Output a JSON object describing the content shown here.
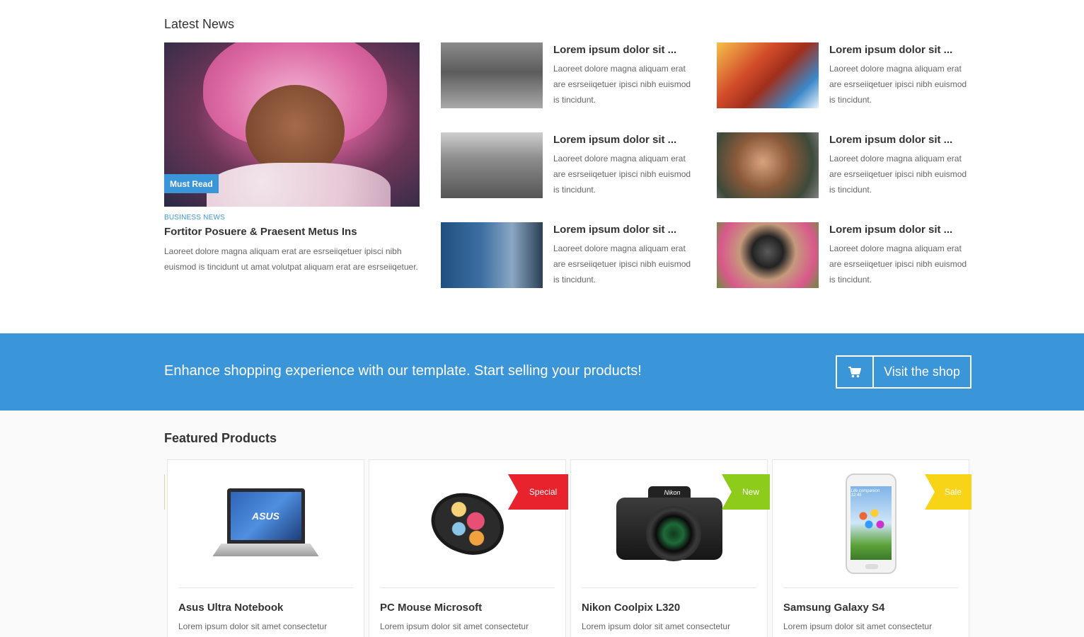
{
  "news": {
    "section_title": "Latest News",
    "featured": {
      "badge": "Must Read",
      "category": "BUSINESS NEWS",
      "title": "Fortitor Posuere & Praesent Metus Ins",
      "text": "Laoreet dolore magna aliquam erat are esrseiiqetuer ipisci nibh euismod is tincidunt ut amat volutpat aliquam erat are esrseiiqetuer."
    },
    "items": [
      {
        "title": "Lorem ipsum dolor sit ...",
        "text": "Laoreet dolore magna aliquam erat are esrseiiqetuer ipisci nibh euismod is tincidunt."
      },
      {
        "title": "Lorem ipsum dolor sit ...",
        "text": "Laoreet dolore magna aliquam erat are esrseiiqetuer ipisci nibh euismod is tincidunt."
      },
      {
        "title": "Lorem ipsum dolor sit ...",
        "text": "Laoreet dolore magna aliquam erat are esrseiiqetuer ipisci nibh euismod is tincidunt."
      },
      {
        "title": "Lorem ipsum dolor sit ...",
        "text": "Laoreet dolore magna aliquam erat are esrseiiqetuer ipisci nibh euismod is tincidunt."
      },
      {
        "title": "Lorem ipsum dolor sit ...",
        "text": "Laoreet dolore magna aliquam erat are esrseiiqetuer ipisci nibh euismod is tincidunt."
      },
      {
        "title": "Lorem ipsum dolor sit ...",
        "text": "Laoreet dolore magna aliquam erat are esrseiiqetuer ipisci nibh euismod is tincidunt."
      }
    ]
  },
  "banner": {
    "text": "Enhance shopping experience with our template. Start selling your products!",
    "button_label": "Visit the shop",
    "button_icon": "cart-icon",
    "background": "#3a95d9"
  },
  "products": {
    "section_title": "Featured Products",
    "items": [
      {
        "name": "Asus Ultra Notebook",
        "desc": "Lorem ipsum dolor sit amet consectetur",
        "ribbon": ""
      },
      {
        "name": "PC Mouse Microsoft",
        "desc": "Lorem ipsum dolor sit amet consectetur",
        "ribbon": "Special",
        "ribbon_color": "#e8232e"
      },
      {
        "name": "Nikon Coolpix L320",
        "desc": "Lorem ipsum dolor sit amet consectetur",
        "ribbon": "New",
        "ribbon_color": "#8ecc1c"
      },
      {
        "name": "Samsung Galaxy S4",
        "desc": "Lorem ipsum dolor sit amet consectetur",
        "ribbon": "Sale",
        "ribbon_color": "#f7d417"
      }
    ],
    "image_labels": {
      "laptop_brand": "ASUS",
      "camera_brand": "Nikon",
      "phone_slogan": "Life companion",
      "phone_time": "12:45"
    }
  }
}
